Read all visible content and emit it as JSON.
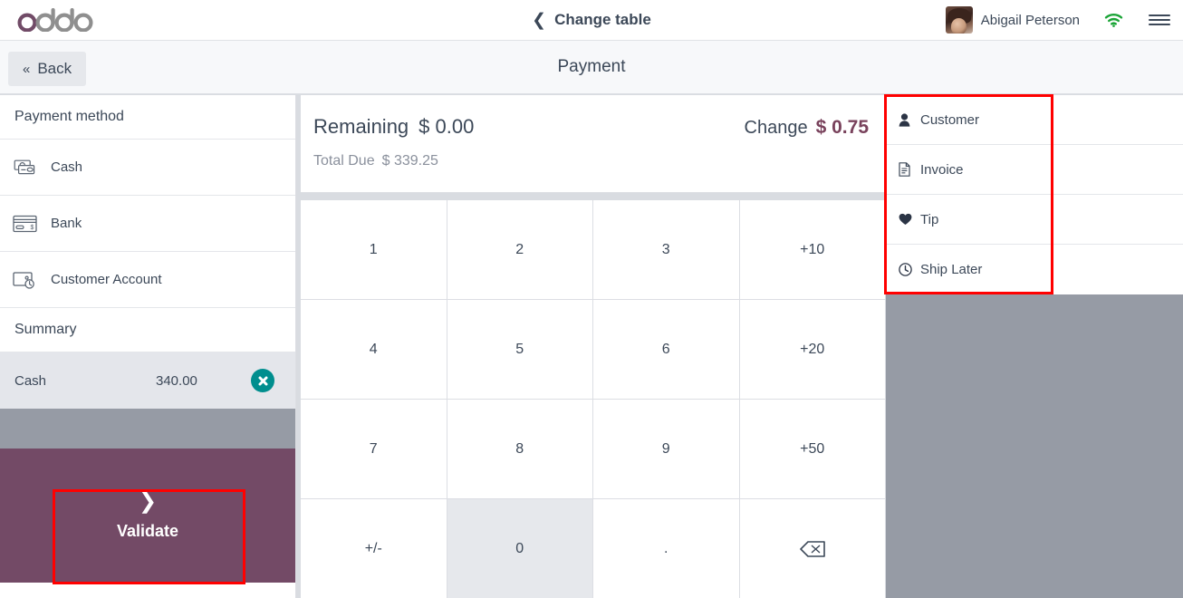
{
  "topbar": {
    "brand": "odoo",
    "change_table_label": "Change table",
    "change_table_icon": "chevron-left-icon",
    "user_name": "Abigail Peterson",
    "avatar_icon": "user-avatar",
    "wifi_icon": "wifi-icon",
    "wifi_color": "#1aa436",
    "menu_icon": "hamburger-menu-icon"
  },
  "subheader": {
    "back_label": "Back",
    "back_icon": "double-chevron-left-icon",
    "title": "Payment"
  },
  "sidebar": {
    "payment_method_header": "Payment method",
    "methods": [
      {
        "label": "Cash",
        "icon": "cash-banknotes-icon"
      },
      {
        "label": "Bank",
        "icon": "credit-card-icon"
      },
      {
        "label": "Customer Account",
        "icon": "wallet-clock-icon"
      }
    ],
    "summary_header": "Summary",
    "summary_rows": [
      {
        "name": "Cash",
        "amount": "340.00",
        "delete_icon": "delete-circle-x-icon"
      }
    ],
    "validate": {
      "label": "Validate",
      "icon": "chevron-right-icon",
      "background": "#734a66"
    }
  },
  "totals": {
    "remaining_label": "Remaining",
    "remaining_value": "$ 0.00",
    "total_due_label": "Total Due",
    "total_due_value": "$ 339.25",
    "change_label": "Change",
    "change_value": "$ 0.75",
    "change_color": "#79425c"
  },
  "numpad": {
    "keys": [
      {
        "label": "1",
        "type": "digit",
        "active": false
      },
      {
        "label": "2",
        "type": "digit",
        "active": false
      },
      {
        "label": "3",
        "type": "digit",
        "active": false
      },
      {
        "label": "+10",
        "type": "preset",
        "active": false
      },
      {
        "label": "4",
        "type": "digit",
        "active": false
      },
      {
        "label": "5",
        "type": "digit",
        "active": false
      },
      {
        "label": "6",
        "type": "digit",
        "active": false
      },
      {
        "label": "+20",
        "type": "preset",
        "active": false
      },
      {
        "label": "7",
        "type": "digit",
        "active": false
      },
      {
        "label": "8",
        "type": "digit",
        "active": false
      },
      {
        "label": "9",
        "type": "digit",
        "active": false
      },
      {
        "label": "+50",
        "type": "preset",
        "active": false
      },
      {
        "label": "+/-",
        "type": "sign",
        "active": false
      },
      {
        "label": "0",
        "type": "digit",
        "active": true
      },
      {
        "label": ".",
        "type": "decimal",
        "active": false
      },
      {
        "label": "",
        "type": "backspace",
        "icon": "backspace-icon",
        "active": false
      }
    ]
  },
  "actions": [
    {
      "label": "Customer",
      "icon": "person-icon"
    },
    {
      "label": "Invoice",
      "icon": "document-icon"
    },
    {
      "label": "Tip",
      "icon": "heart-icon"
    },
    {
      "label": "Ship Later",
      "icon": "clock-icon"
    }
  ],
  "annotations": {
    "color": "#ff0000",
    "boxes": [
      "actions-panel",
      "validate-button"
    ]
  }
}
